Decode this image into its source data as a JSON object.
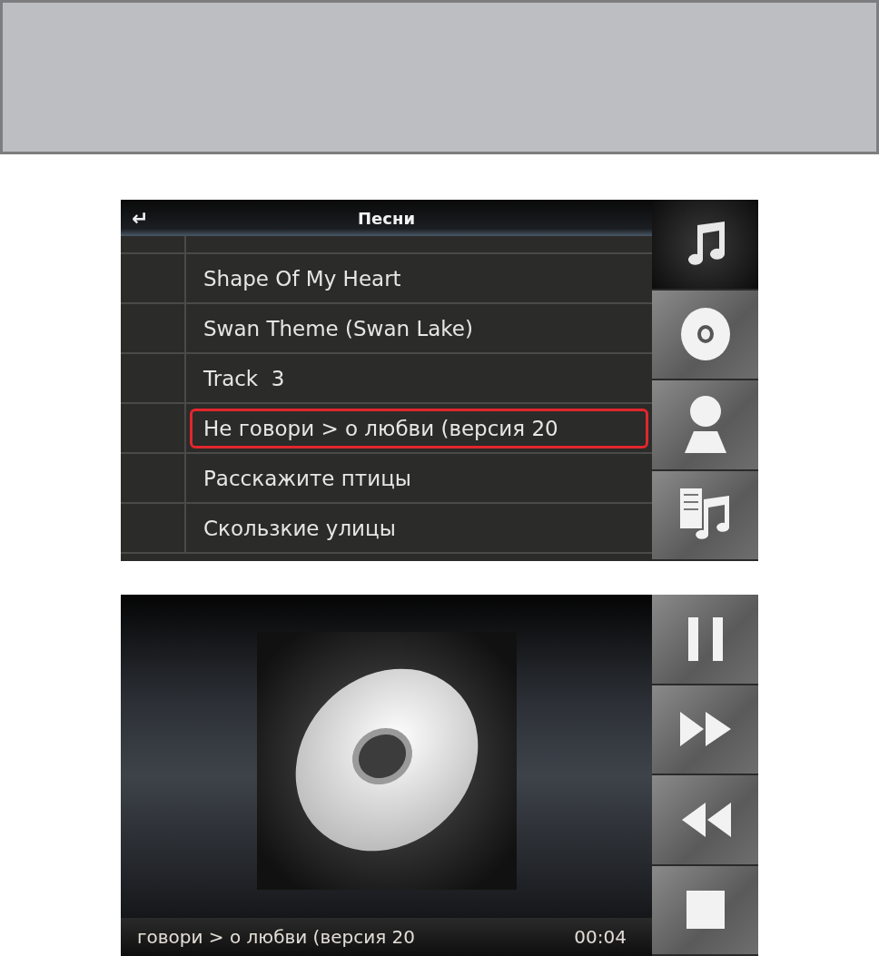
{
  "song_list_screen": {
    "back": "↵",
    "title": "Песни",
    "rows": [
      {
        "title": "Shape Of My Heart",
        "selected": false
      },
      {
        "title": "Swan Theme (Swan Lake)",
        "selected": false
      },
      {
        "title": "Track  3",
        "selected": false
      },
      {
        "title": "Не говори > о любви (версия 20",
        "selected": true
      },
      {
        "title": "Расскажите птицы",
        "selected": false
      },
      {
        "title": "Скользкие улицы",
        "selected": false
      }
    ],
    "tabs": [
      {
        "kind": "songs",
        "selected": true
      },
      {
        "kind": "albums",
        "selected": false
      },
      {
        "kind": "artists",
        "selected": false
      },
      {
        "kind": "playlists",
        "selected": false
      }
    ]
  },
  "player_screen": {
    "title": "говори > о любви (версия 20",
    "time": "00:04",
    "controls": [
      {
        "kind": "pause"
      },
      {
        "kind": "forward"
      },
      {
        "kind": "rewind"
      },
      {
        "kind": "stop"
      }
    ]
  }
}
